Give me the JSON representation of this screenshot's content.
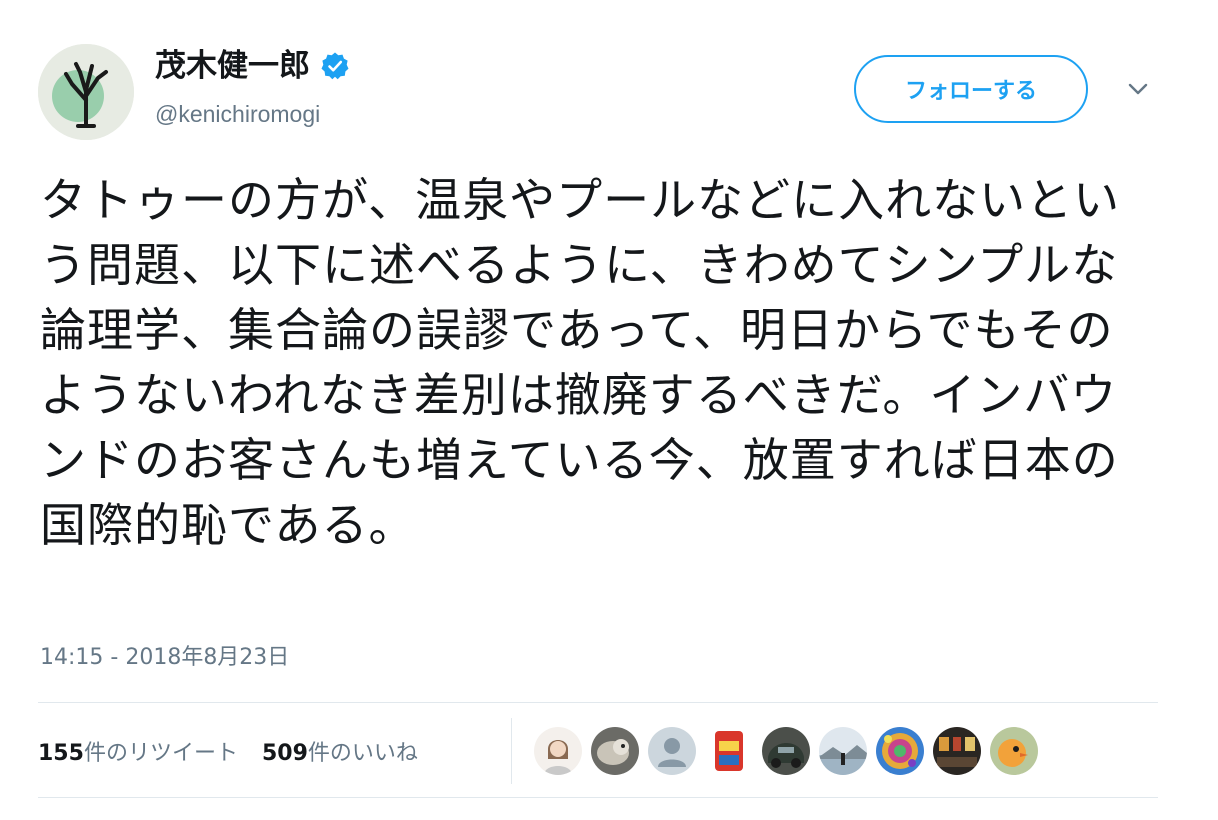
{
  "user": {
    "display_name": "茂木健一郎",
    "handle": "@kenichiromogi",
    "verified": true,
    "avatar_icon": "tree-drawing-avatar"
  },
  "actions": {
    "follow_label": "フォローする",
    "menu_icon": "chevron-down-icon"
  },
  "tweet": {
    "text": "タトゥーの方が、温泉やプールなどに入れないという問題、以下に述べるように、きわめてシンプルな論理学、集合論の誤謬であって、明日からでもそのようないわれなき差別は撤廃するべきだ。インバウンドのお客さんも増えている今、放置すれば日本の国際的恥である。",
    "timestamp": "14:15 - 2018年8月23日"
  },
  "stats": {
    "retweets_count": "155",
    "retweets_label": "件のリツイート",
    "likes_count": "509",
    "likes_label": "件のいいね"
  },
  "likers": [
    {
      "name": "liker-avatar-1"
    },
    {
      "name": "liker-avatar-2"
    },
    {
      "name": "liker-avatar-3"
    },
    {
      "name": "liker-avatar-4"
    },
    {
      "name": "liker-avatar-5"
    },
    {
      "name": "liker-avatar-6"
    },
    {
      "name": "liker-avatar-7"
    },
    {
      "name": "liker-avatar-8"
    },
    {
      "name": "liker-avatar-9"
    }
  ],
  "colors": {
    "accent": "#1da1f2",
    "text_primary": "#14171a",
    "text_secondary": "#657786",
    "border": "#e1e8ed"
  }
}
